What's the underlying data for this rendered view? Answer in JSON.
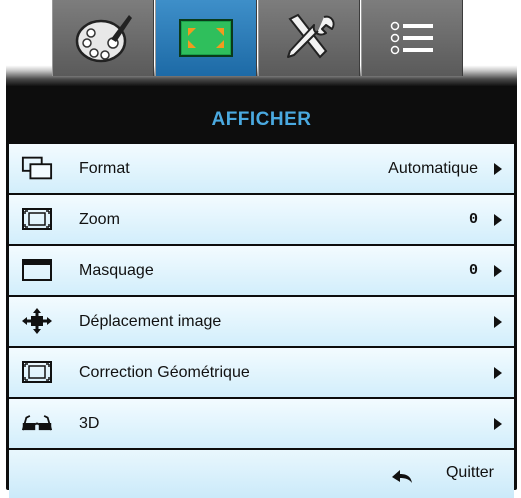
{
  "tabs": [
    {
      "name": "palette-tab",
      "icon": "palette-icon",
      "active": false
    },
    {
      "name": "display-tab",
      "icon": "display-icon",
      "active": true
    },
    {
      "name": "settings-tab",
      "icon": "tools-icon",
      "active": false
    },
    {
      "name": "options-tab",
      "icon": "list-icon",
      "active": false
    }
  ],
  "title": "AFFICHER",
  "menu": {
    "items": [
      {
        "label": "Format",
        "value": "Automatique",
        "icon": "format-icon"
      },
      {
        "label": "Zoom",
        "value": "0",
        "icon": "zoom-icon"
      },
      {
        "label": "Masquage",
        "value": "0",
        "icon": "masking-icon"
      },
      {
        "label": "Déplacement image",
        "value": "",
        "icon": "move-icon"
      },
      {
        "label": "Correction Géométrique",
        "value": "",
        "icon": "geometric-correction-icon"
      },
      {
        "label": "3D",
        "value": "",
        "icon": "3d-glasses-icon"
      }
    ]
  },
  "footer": {
    "exit_label": "Quitter",
    "exit_icon": "back-arrow-icon"
  },
  "colors": {
    "active_tab": "#2a7bbd",
    "title": "#4aa9e0",
    "row_bg": "#dff3fc",
    "background": "#0d0d0d"
  }
}
